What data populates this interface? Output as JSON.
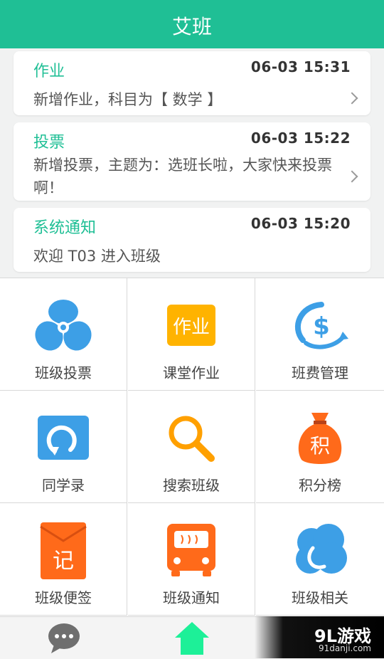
{
  "header": {
    "title": "艾班"
  },
  "notifications": [
    {
      "title": "作业",
      "time": "06-03 15:31",
      "body": "新增作业，科目为【 数学 】"
    },
    {
      "title": "投票",
      "time": "06-03 15:22",
      "body": "新增投票，主题为：选班长啦，大家快来投票啊！"
    },
    {
      "title": "系统通知",
      "time": "06-03 15:20",
      "body": "欢迎 T03 进入班级"
    }
  ],
  "menu": [
    {
      "label": "班级投票",
      "icon": "fan-icon"
    },
    {
      "label": "课堂作业",
      "icon": "homework-icon",
      "icon_text": "作业"
    },
    {
      "label": "班费管理",
      "icon": "dollar-icon"
    },
    {
      "label": "同学录",
      "icon": "refresh-icon"
    },
    {
      "label": "搜索班级",
      "icon": "search-icon"
    },
    {
      "label": "积分榜",
      "icon": "money-bag-icon",
      "icon_text": "积"
    },
    {
      "label": "班级便签",
      "icon": "note-icon",
      "icon_text": "记"
    },
    {
      "label": "班级通知",
      "icon": "bus-icon"
    },
    {
      "label": "班级相关",
      "icon": "cloud-icon"
    }
  ],
  "bottom_nav": [
    {
      "name": "chat",
      "icon": "chat-bubble-icon"
    },
    {
      "name": "home",
      "icon": "home-icon"
    }
  ],
  "watermark": {
    "line1": "9L游戏",
    "line2": "91danji.com"
  },
  "colors": {
    "accent": "#1fbf95",
    "blue": "#3d9fe6",
    "orange": "#ff6a1a",
    "yellow": "#ffb300",
    "home_green": "#1df098"
  }
}
